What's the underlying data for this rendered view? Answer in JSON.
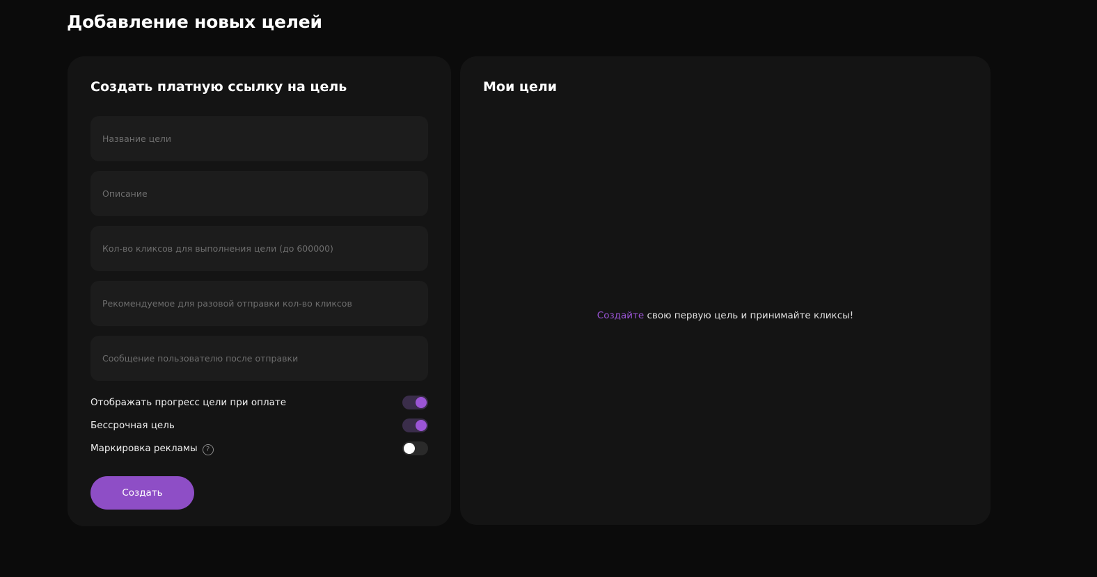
{
  "page": {
    "title": "Добавление новых целей"
  },
  "create_card": {
    "title": "Создать платную ссылку на цель",
    "fields": [
      {
        "placeholder": "Название цели",
        "value": ""
      },
      {
        "placeholder": "Описание",
        "value": ""
      },
      {
        "placeholder": "Кол-во кликсов для выполнения цели (до 600000)",
        "value": ""
      },
      {
        "placeholder": "Рекомендуемое для разовой отправки кол-во кликсов",
        "value": ""
      },
      {
        "placeholder": "Сообщение пользователю после отправки",
        "value": ""
      }
    ],
    "toggles": [
      {
        "label": "Отображать прогресс цели при оплате",
        "state": "on"
      },
      {
        "label": "Бессрочная цель",
        "state": "on"
      },
      {
        "label": "Маркировка рекламы",
        "state": "off",
        "help_icon": "question-circle-icon"
      }
    ],
    "submit_label": "Создать"
  },
  "goals_card": {
    "title": "Мои цели",
    "empty_state": {
      "link_text": "Создайте",
      "text": " свою первую цель и принимайте кликсы!"
    }
  },
  "colors": {
    "background": "#0b0b0b",
    "card": "#141414",
    "field": "#1c1c1c",
    "accent": "#8e4ec6",
    "accent_knob": "#9b55d6"
  }
}
